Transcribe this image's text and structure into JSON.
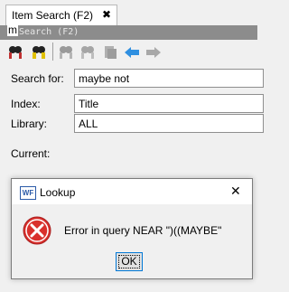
{
  "tab": {
    "label": "Item Search (F2)",
    "close_glyph": "✖"
  },
  "panel": {
    "title": "n Search (F2)",
    "caret_text": "m"
  },
  "toolbar": {
    "icons": [
      "search-icon",
      "search-all-icon",
      "disabled-search-icon",
      "disabled-search-icon-2",
      "disabled-item-icon",
      "back-arrow-icon",
      "forward-arrow-icon"
    ]
  },
  "form": {
    "search_label": "Search for:",
    "search_value": "maybe not",
    "index_label": "Index:",
    "index_value": "Title",
    "library_label": "Library:",
    "library_value": "ALL",
    "current_label": "Current:"
  },
  "dialog": {
    "title": "Lookup",
    "app_icon_text": "WF",
    "message": "Error in query NEAR \")((MAYBE\"",
    "ok_label": "OK",
    "close_glyph": "✕"
  },
  "colors": {
    "accent": "#0078d7",
    "error": "#d9302c",
    "arrow_blue": "#2f8fe0"
  }
}
